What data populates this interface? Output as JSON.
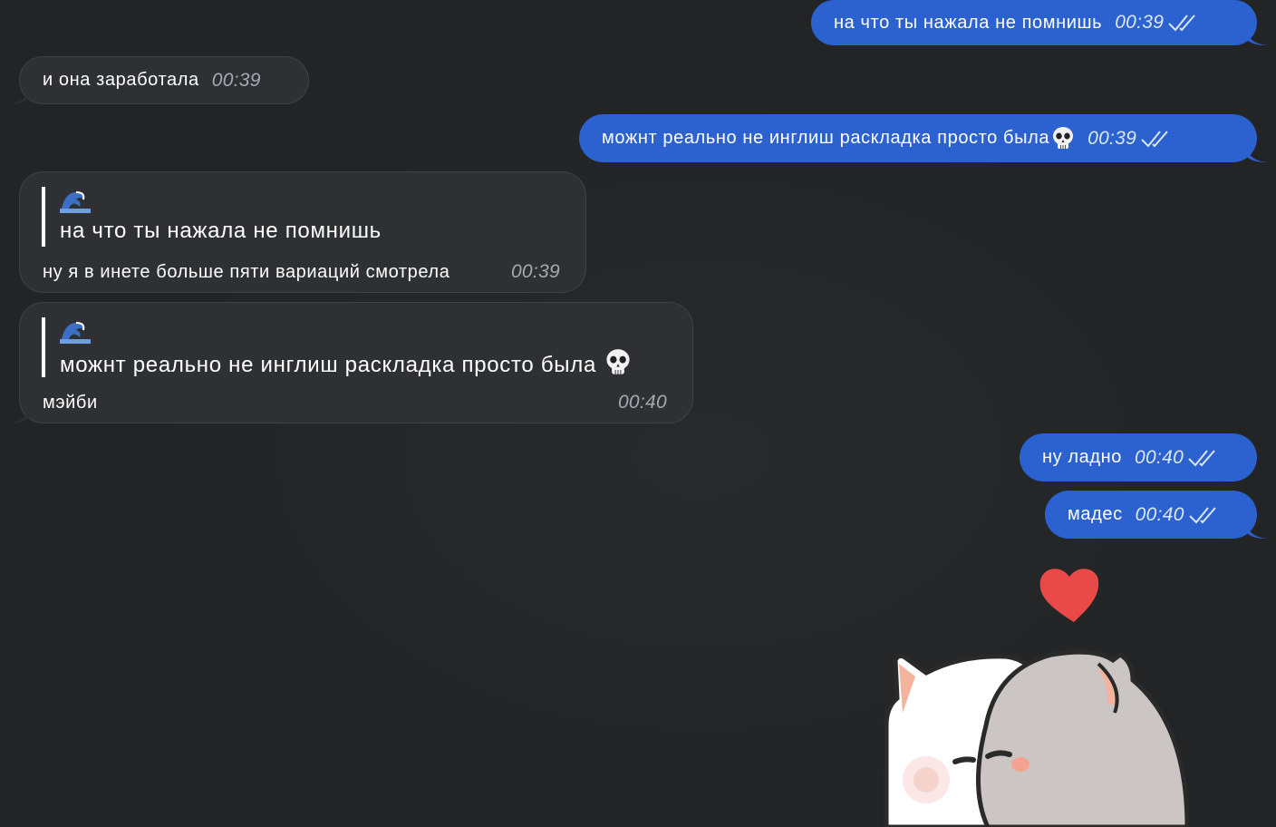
{
  "messages": [
    {
      "id": "m1",
      "direction": "out",
      "text": "на что ты нажала не помнишь",
      "time": "00:39"
    },
    {
      "id": "m2",
      "direction": "in",
      "text": "и она заработала",
      "time": "00:39"
    },
    {
      "id": "m3",
      "direction": "out",
      "text": "можнт реально не инглиш раскладка просто была",
      "emoji": "skull-icon",
      "time": "00:39"
    },
    {
      "id": "m4",
      "direction": "in",
      "reply_to": {
        "text": "на что ты нажала не помнишь"
      },
      "text": "ну я в инете больше пяти вариаций смотрела",
      "time": "00:39"
    },
    {
      "id": "m5",
      "direction": "in",
      "reply_to": {
        "text": "можнт реально не инглиш раскладка просто была",
        "emoji": "skull-icon"
      },
      "text": "мэйби",
      "time": "00:40"
    },
    {
      "id": "m6",
      "direction": "out",
      "text": "ну ладно",
      "time": "00:40"
    },
    {
      "id": "m7",
      "direction": "out",
      "text": "мадес",
      "time": "00:40"
    }
  ],
  "sticker": {
    "name": "cats-hug-sticker",
    "heart_color": "#ea4a47"
  },
  "colors": {
    "background": "#222426",
    "outgoing": "#2b62cf",
    "incoming": "#2e3033"
  }
}
